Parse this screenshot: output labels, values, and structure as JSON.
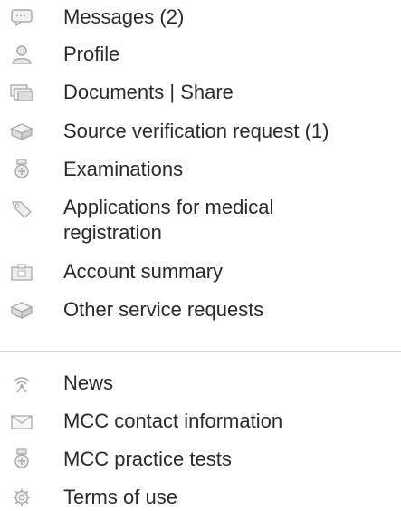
{
  "menu": {
    "primary": [
      {
        "label": "Messages (2)",
        "icon": "chat-bubble-icon"
      },
      {
        "label": "Profile",
        "icon": "user-icon"
      },
      {
        "label": "Documents | Share",
        "icon": "documents-icon"
      },
      {
        "label": "Source verification request (1)",
        "icon": "box-icon"
      },
      {
        "label": "Examinations",
        "icon": "medal-icon"
      },
      {
        "label": "Applications for medical registration",
        "icon": "tag-icon"
      },
      {
        "label": "Account summary",
        "icon": "wallet-icon"
      },
      {
        "label": "Other service requests",
        "icon": "box-icon"
      }
    ],
    "secondary": [
      {
        "label": "News",
        "icon": "broadcast-icon"
      },
      {
        "label": "MCC contact information",
        "icon": "envelope-icon"
      },
      {
        "label": "MCC practice tests",
        "icon": "medal-icon"
      },
      {
        "label": "Terms of use",
        "icon": "gear-icon"
      }
    ]
  },
  "colors": {
    "text": "#2b2b2b",
    "icon": "#a9a9a9",
    "divider": "#d6d6d6"
  }
}
